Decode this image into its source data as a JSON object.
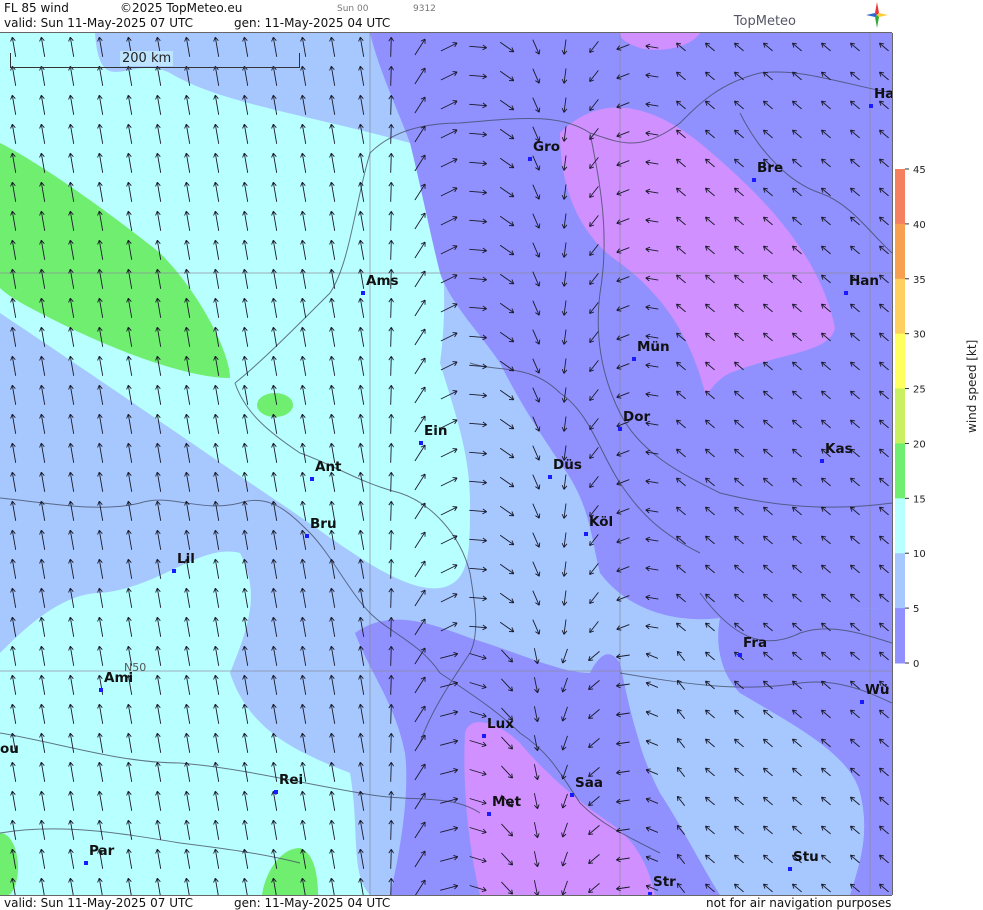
{
  "header": {
    "product": "FL 85 wind",
    "copyright": "©2025 TopMeteo.eu",
    "run_label": "Sun 00",
    "code": "9312",
    "valid": "valid:  Sun  11-May-2025  07 UTC",
    "gen": "gen: 11-May-2025 04 UTC",
    "logo": "TopMeteo"
  },
  "footer": {
    "valid": "valid:  Sun  11-May-2025  07 UTC",
    "gen": "gen: 11-May-2025 04 UTC",
    "disclaimer": "not for air navigation purposes"
  },
  "map": {
    "scale_label": "200 km",
    "grid_label": "N50",
    "cities": [
      {
        "name": "Gro"
      },
      {
        "name": "Bre"
      },
      {
        "name": "Ha"
      },
      {
        "name": "Ams"
      },
      {
        "name": "Han"
      },
      {
        "name": "Mün"
      },
      {
        "name": "Ein"
      },
      {
        "name": "Dor"
      },
      {
        "name": "Kas"
      },
      {
        "name": "Ant"
      },
      {
        "name": "Düs"
      },
      {
        "name": "Bru"
      },
      {
        "name": "Köl"
      },
      {
        "name": "Lil"
      },
      {
        "name": "Fra"
      },
      {
        "name": "Ami"
      },
      {
        "name": "Wü"
      },
      {
        "name": "Lux"
      },
      {
        "name": "ou"
      },
      {
        "name": "Rei"
      },
      {
        "name": "Saa"
      },
      {
        "name": "Met"
      },
      {
        "name": "Par"
      },
      {
        "name": "Stu"
      },
      {
        "name": "Str"
      }
    ]
  },
  "legend": {
    "title": "wind  speed  [kt]",
    "ticks": [
      "45",
      "40",
      "35",
      "30",
      "25",
      "20",
      "15",
      "10",
      "5",
      "0"
    ],
    "colors": [
      "#f58060",
      "#f7a050",
      "#ffd060",
      "#ffff60",
      "#c8f060",
      "#70ee70",
      "#b8ffff",
      "#a6c8ff",
      "#9090ff",
      "#d090ff"
    ]
  }
}
